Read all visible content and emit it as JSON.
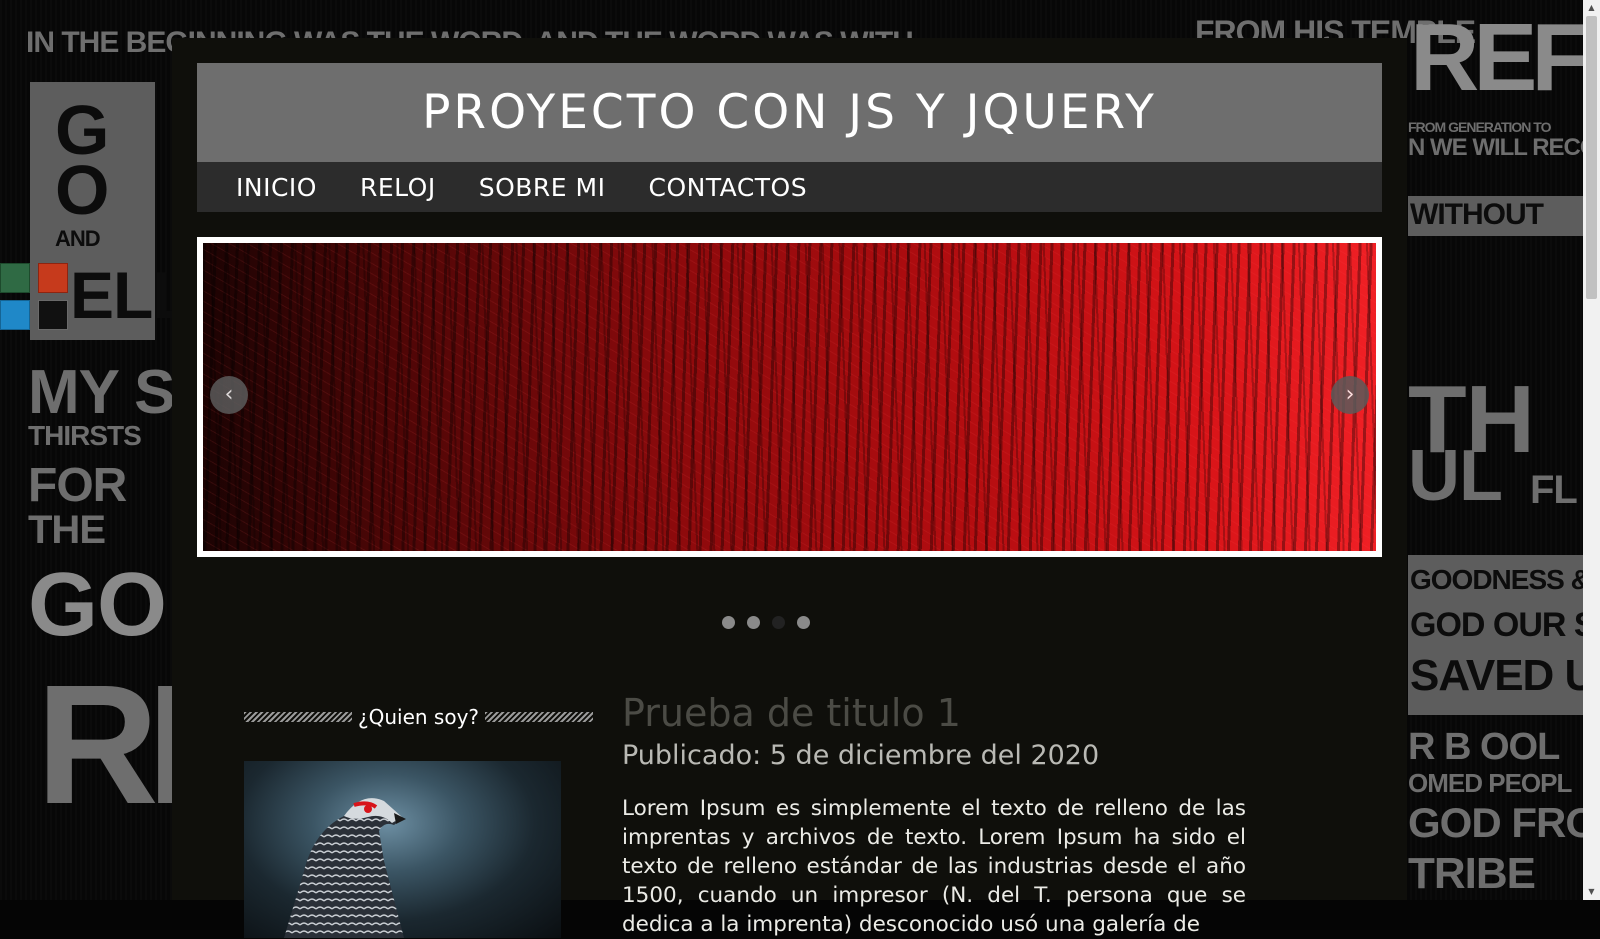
{
  "site": {
    "title": "PROYECTO CON JS Y JQUERY"
  },
  "nav": {
    "items": [
      {
        "label": "INICIO"
      },
      {
        "label": "RELOJ"
      },
      {
        "label": "SOBRE MI"
      },
      {
        "label": "CONTACTOS"
      }
    ]
  },
  "theme_swatches": [
    {
      "name": "green",
      "color": "#2f6a44"
    },
    {
      "name": "red",
      "color": "#c63a1c"
    },
    {
      "name": "blue",
      "color": "#1f88c8"
    },
    {
      "name": "black",
      "color": "#111111"
    }
  ],
  "slider": {
    "prev_icon": "chevron-left-icon",
    "next_icon": "chevron-right-icon",
    "prev_glyph": "‹",
    "next_glyph": "›",
    "slide_count": 4,
    "active_index": 2
  },
  "sidebar": {
    "title": "¿Quien soy?"
  },
  "article": {
    "title": "Prueba de titulo 1",
    "date": "Publicado: 5 de diciembre del 2020",
    "body": "Lorem Ipsum es simplemente el texto de relleno de las imprentas y archivos de texto. Lorem Ipsum ha sido el texto de relleno estándar de las industrias desde el año 1500, cuando un impresor (N. del T. persona que se dedica a la imprenta) desconocido usó una galería de"
  },
  "background": {
    "words": [
      "IN THE BEGINNING WAS THE WORD, AND THE WORD WAS WITH",
      "FROM HIS TEMPLE",
      "G",
      "O",
      "AND",
      "ELL",
      "MY S",
      "THIRSTS",
      "FOR",
      "THE",
      "GO",
      "RIS",
      "REFY",
      "FROM GENERATION TO",
      "N WE WILL RECOUNT",
      "WITHOUT",
      "TH",
      "UL",
      "FL",
      "GOODNESS & LOVING",
      "GOD OUR SAVIOR",
      "SAVED US",
      "R B OOL",
      "OMED PEOPL",
      "GOD FROM",
      "TRIBE"
    ]
  }
}
